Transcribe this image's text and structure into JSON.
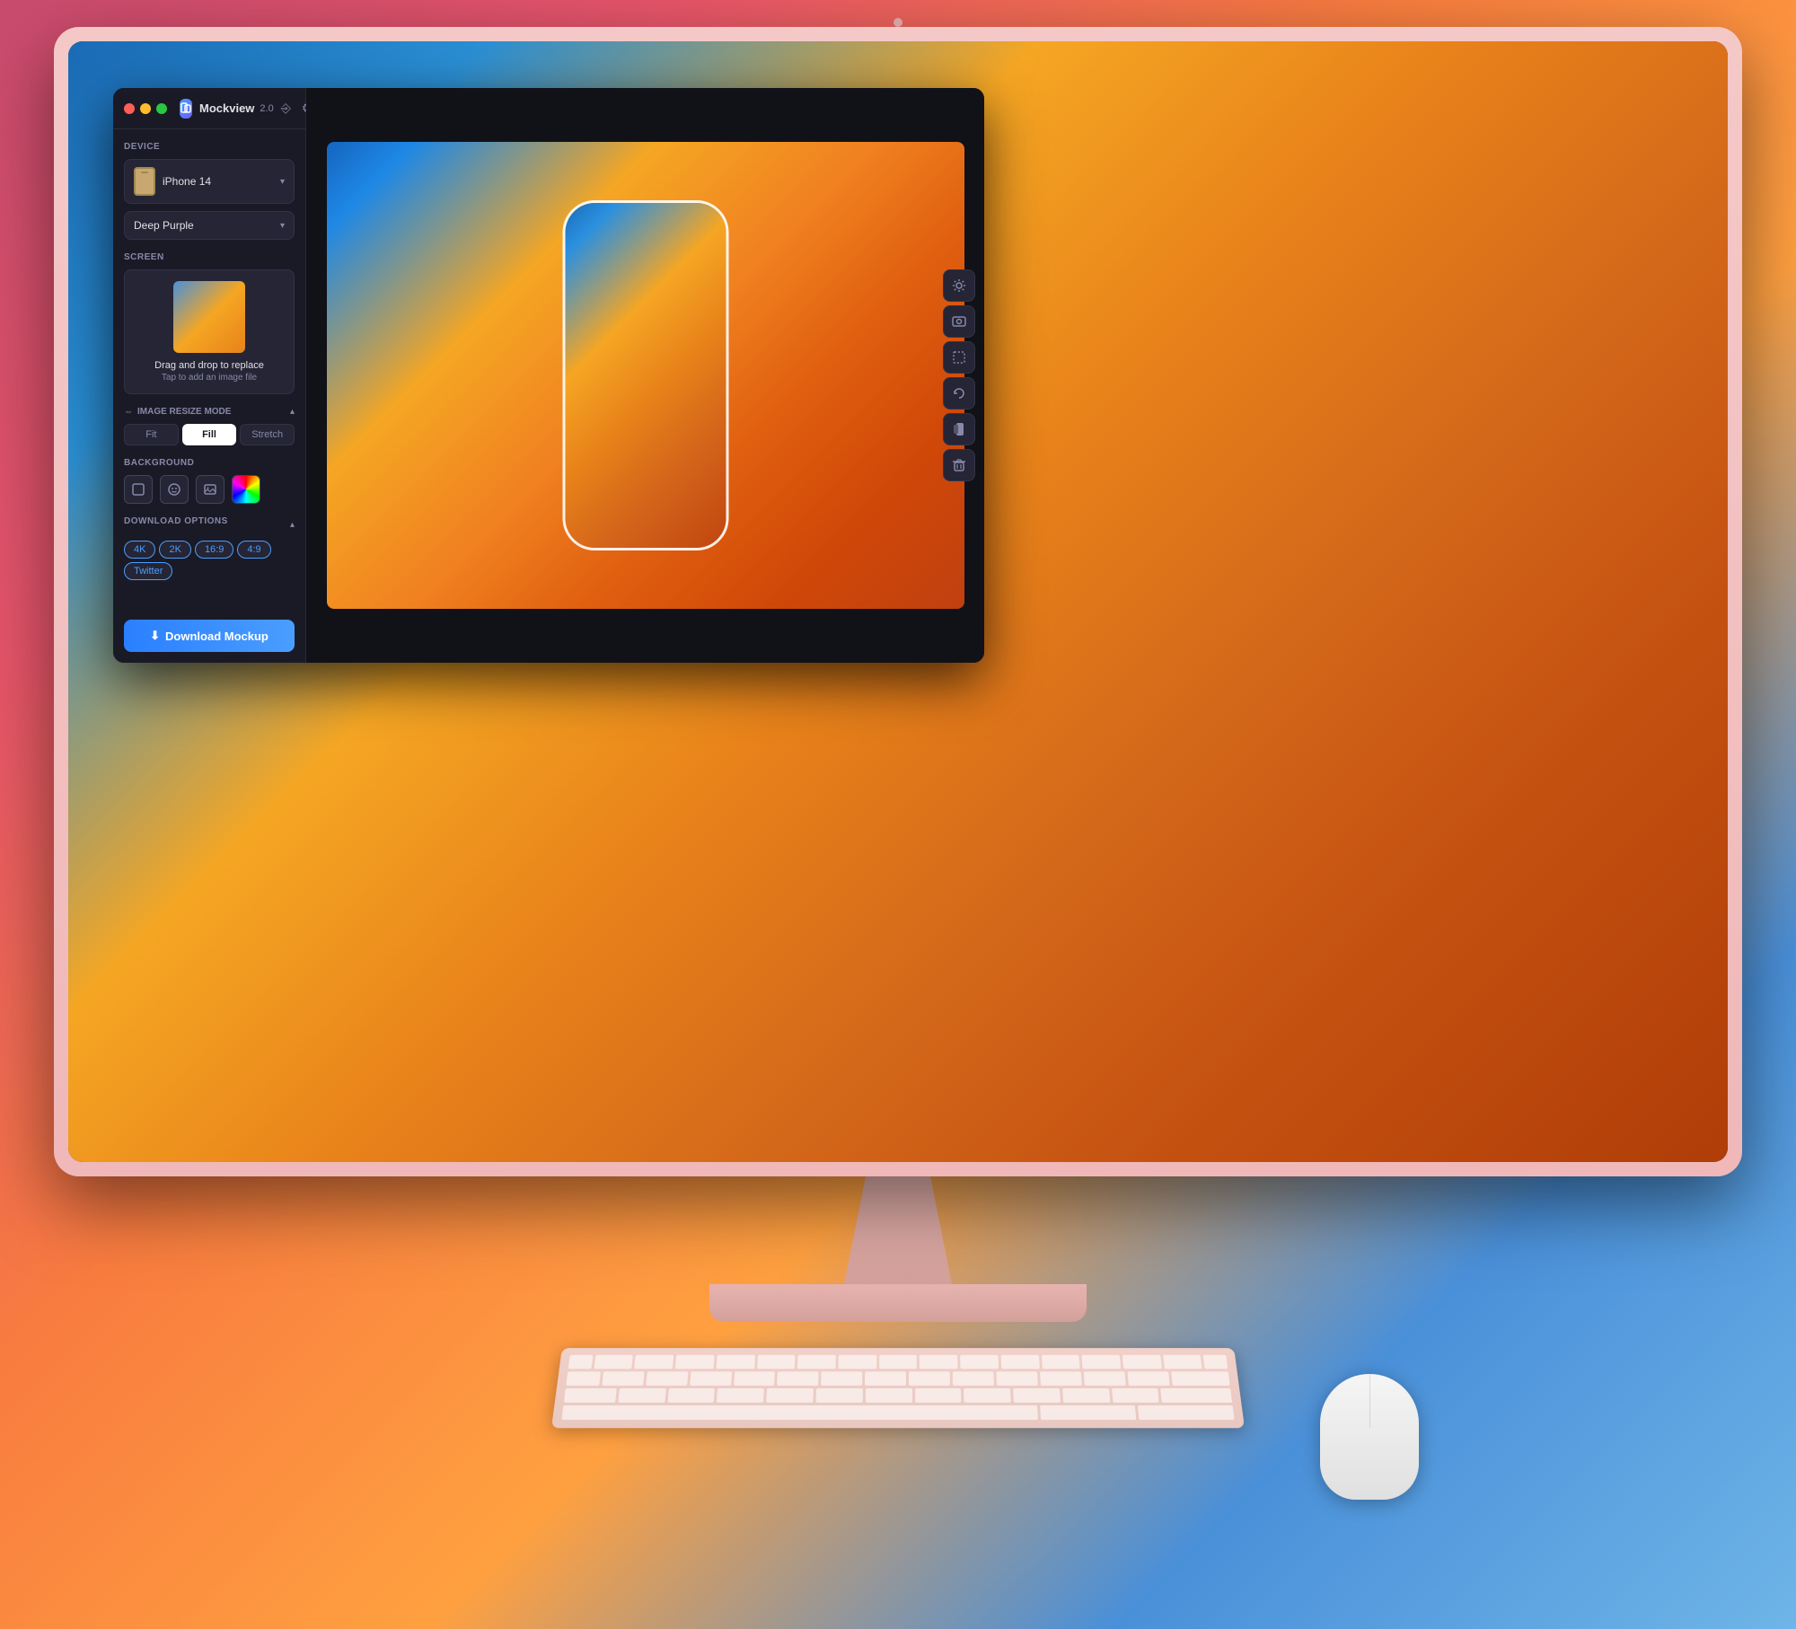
{
  "app": {
    "title": "Mockview",
    "version": "2.0",
    "window_controls": {
      "close": "●",
      "minimize": "●",
      "maximize": "●"
    }
  },
  "sidebar": {
    "device_section_label": "Device",
    "device_name": "iPhone 14",
    "device_color": "Deep Purple",
    "screen_section_label": "Screen",
    "drop_text": "Drag and drop to replace",
    "drop_subtext": "Tap to add an image file",
    "resize_section_label": "Image Resize Mode",
    "resize_options": [
      "Fit",
      "Fill",
      "Stretch"
    ],
    "resize_active": "Fill",
    "background_section_label": "Background",
    "download_section_label": "Download Options",
    "download_formats": [
      "4K",
      "2K",
      "16:9",
      "4:9",
      "Twitter"
    ],
    "download_button_label": "Download Mockup"
  },
  "toolbar": {
    "sun_icon": "☀",
    "camera_icon": "⊡",
    "crop_icon": "⊞",
    "rotate_icon": "↺",
    "phone_icon": "▮",
    "trash_icon": "🗑"
  },
  "colors": {
    "accent": "#4a9eff",
    "bg_dark": "#1a1a26",
    "sidebar_bg": "#1a1a26",
    "canvas_bg": "#111118",
    "text_primary": "#e0e0e8",
    "text_muted": "#8888aa",
    "imac_color": "#e8b4b0"
  }
}
